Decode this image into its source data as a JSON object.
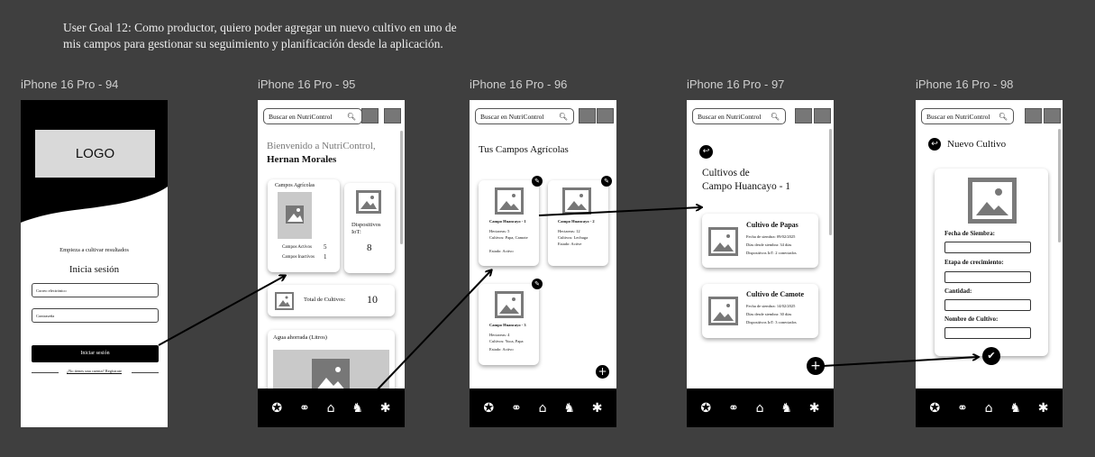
{
  "goal": {
    "line1": "User Goal 12: Como productor, quiero poder agregar un nuevo cultivo en uno de",
    "line2": "mis campos para gestionar su seguimiento y planificación desde la aplicación."
  },
  "frames": {
    "f1": "iPhone 16 Pro - 94",
    "f2": "iPhone 16 Pro - 95",
    "f3": "iPhone 16 Pro - 96",
    "f4": "iPhone 16 Pro - 97",
    "f5": "iPhone 16 Pro - 98"
  },
  "search": {
    "placeholder": "Buscar en NutriControl"
  },
  "login": {
    "logo": "LOGO",
    "tagline": "Empieza a cultivar resultados",
    "title": "Inicia sesión",
    "email_placeholder": "Correo electrónico",
    "password_placeholder": "Contraseña",
    "button": "Iniciar sesión",
    "register": "¿No tienes una cuenta? Regístrate"
  },
  "home": {
    "welcome": "Bienvenido a NutriControl,",
    "user": "Hernan Morales",
    "campos_title": "Campos Agrícolas",
    "activos_label": "Campos Activos",
    "activos_value": "5",
    "inactivos_label": "Campos Inactivos",
    "inactivos_value": "1",
    "dispositivos_label": "Dispositivos IoT:",
    "dispositivos_value": "8",
    "cultivos_label": "Total de Cultivos:",
    "cultivos_value": "10",
    "agua_label": "Agua ahorrada (Litros)"
  },
  "campos": {
    "title": "Tus Campos Agrícolas",
    "items": [
      {
        "name": "Campo Huancayo - 1",
        "l1": "Hectareas: 5",
        "l2": "Cultivos: Papa, Camote",
        "l3": "Estado: Activo"
      },
      {
        "name": "Campo Huancayo - 2",
        "l1": "Hectareas: 12",
        "l2": "Cultivos: Lechuga",
        "l3": "Estado: Active"
      },
      {
        "name": "Campo Huancayo - 3",
        "l1": "Hectareas: 4",
        "l2": "Cultivos: Yuca, Papa",
        "l3": "Estado: Activo"
      }
    ]
  },
  "cultivos": {
    "title1": "Cultivos de",
    "title2": "Campo Huancayo - 1",
    "items": [
      {
        "name": "Cultivo de Papas",
        "l1": "Fecha de siembra: 09/02/2025",
        "l2": "Días desde siembra: 34 días",
        "l3": "Dispositivos IoT: 2 conectados"
      },
      {
        "name": "Cultivo de Camote",
        "l1": "Fecha de siembra: 14/02/2025",
        "l2": "Días desde siembra: 30 días",
        "l3": "Dispositivos IoT: 3 conectados"
      }
    ]
  },
  "nuevo": {
    "title": "Nuevo Cultivo",
    "fecha": "Fecha de Siembra:",
    "etapa": "Etapa de crecimiento:",
    "cantidad": "Cantidad:",
    "nombre": "Nombre de Cultivo:"
  },
  "icons": {
    "nav": [
      "settings-icon",
      "search-icon",
      "home-icon",
      "farmer-icon",
      "bulb-icon"
    ]
  }
}
